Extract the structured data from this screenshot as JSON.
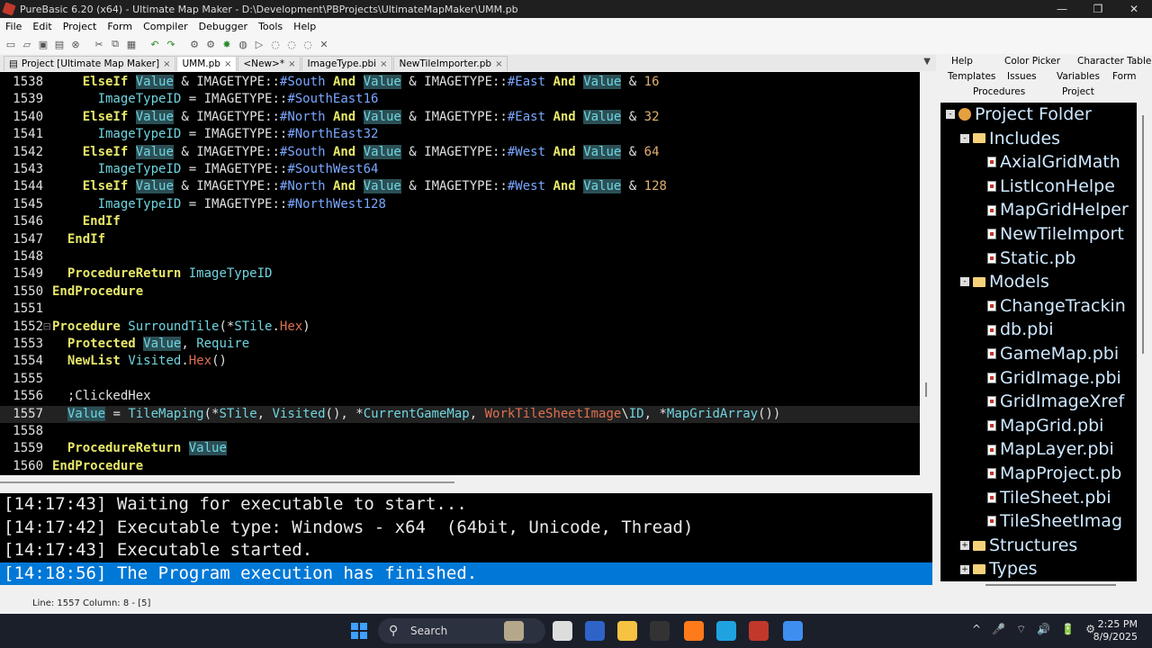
{
  "window": {
    "title": "PureBasic 6.20 (x64) - Ultimate Map Maker - D:\\Development\\PBProjects\\UltimateMapMaker\\UMM.pb",
    "minimize": "—",
    "restore": "❐",
    "close": "✕"
  },
  "menu": [
    "File",
    "Edit",
    "Project",
    "Form",
    "Compiler",
    "Debugger",
    "Tools",
    "Help"
  ],
  "file_tabs": [
    {
      "label": "Project [Ultimate Map Maker]",
      "active": false
    },
    {
      "label": "UMM.pb",
      "active": true
    },
    {
      "label": "<New>*",
      "active": false
    },
    {
      "label": "ImageType.pbi",
      "active": false
    },
    {
      "label": "NewTileImporter.pb",
      "active": false
    }
  ],
  "tab_close": "×",
  "tab_menu": "▼",
  "right_tabs": {
    "help": "Help",
    "color_picker": "Color Picker",
    "character_table": "Character Table",
    "templates": "Templates",
    "issues": "Issues",
    "variables": "Variables",
    "form": "Form",
    "procedures": "Procedures",
    "project": "Project"
  },
  "code_lines": [
    {
      "n": "1538",
      "text": "    ElseIf Value & IMAGETYPE::#South And Value & IMAGETYPE::#East And Value & 16"
    },
    {
      "n": "1539",
      "text": "      ImageTypeID = IMAGETYPE::#SouthEast16"
    },
    {
      "n": "1540",
      "text": "    ElseIf Value & IMAGETYPE::#North And Value & IMAGETYPE::#East And Value & 32"
    },
    {
      "n": "1541",
      "text": "      ImageTypeID = IMAGETYPE::#NorthEast32"
    },
    {
      "n": "1542",
      "text": "    ElseIf Value & IMAGETYPE::#South And Value & IMAGETYPE::#West And Value & 64"
    },
    {
      "n": "1543",
      "text": "      ImageTypeID = IMAGETYPE::#SouthWest64"
    },
    {
      "n": "1544",
      "text": "    ElseIf Value & IMAGETYPE::#North And Value & IMAGETYPE::#West And Value & 128"
    },
    {
      "n": "1545",
      "text": "      ImageTypeID = IMAGETYPE::#NorthWest128"
    },
    {
      "n": "1546",
      "text": "    EndIf"
    },
    {
      "n": "1547",
      "text": "  EndIf"
    },
    {
      "n": "1548",
      "text": ""
    },
    {
      "n": "1549",
      "text": "  ProcedureReturn ImageTypeID"
    },
    {
      "n": "1550",
      "text": "EndProcedure"
    },
    {
      "n": "1551",
      "text": ""
    },
    {
      "n": "1552",
      "text": "Procedure SurroundTile(*STile.Hex)"
    },
    {
      "n": "1553",
      "text": "  Protected Value, Require"
    },
    {
      "n": "1554",
      "text": "  NewList Visited.Hex()"
    },
    {
      "n": "1555",
      "text": ""
    },
    {
      "n": "1556",
      "text": "  ;ClickedHex"
    },
    {
      "n": "1557",
      "text": "  Value = TileMaping(*STile, Visited(), *CurrentGameMap, WorkTileSheetImage\\ID, *MapGridArray())"
    },
    {
      "n": "1558",
      "text": ""
    },
    {
      "n": "1559",
      "text": "  ProcedureReturn Value"
    },
    {
      "n": "1560",
      "text": "EndProcedure"
    }
  ],
  "current_line_index": 19,
  "log": [
    {
      "text": "[14:17:43] Waiting for executable to start...",
      "selected": false
    },
    {
      "text": "[14:17:42] Executable type: Windows - x64  (64bit, Unicode, Thread)",
      "selected": false
    },
    {
      "text": "[14:17:43] Executable started.",
      "selected": false
    },
    {
      "text": "[14:18:56] The Program execution has finished.",
      "selected": true
    }
  ],
  "status": "Line: 1557  Column: 8 - [5]",
  "tree": [
    {
      "depth": 0,
      "kind": "root",
      "label": "Project Folder",
      "toggle": "-"
    },
    {
      "depth": 1,
      "kind": "folder",
      "label": "Includes",
      "toggle": "-"
    },
    {
      "depth": 2,
      "kind": "file",
      "label": "AxialGridMath"
    },
    {
      "depth": 2,
      "kind": "file",
      "label": "ListIconHelpe"
    },
    {
      "depth": 2,
      "kind": "file",
      "label": "MapGridHelper"
    },
    {
      "depth": 2,
      "kind": "file",
      "label": "NewTileImport"
    },
    {
      "depth": 2,
      "kind": "file",
      "label": "Static.pb"
    },
    {
      "depth": 1,
      "kind": "folder",
      "label": "Models",
      "toggle": "-"
    },
    {
      "depth": 2,
      "kind": "file",
      "label": "ChangeTrackin"
    },
    {
      "depth": 2,
      "kind": "file",
      "label": "db.pbi"
    },
    {
      "depth": 2,
      "kind": "file",
      "label": "GameMap.pbi"
    },
    {
      "depth": 2,
      "kind": "file",
      "label": "GridImage.pbi"
    },
    {
      "depth": 2,
      "kind": "file",
      "label": "GridImageXref"
    },
    {
      "depth": 2,
      "kind": "file",
      "label": "MapGrid.pbi"
    },
    {
      "depth": 2,
      "kind": "file",
      "label": "MapLayer.pbi"
    },
    {
      "depth": 2,
      "kind": "file",
      "label": "MapProject.pb"
    },
    {
      "depth": 2,
      "kind": "file",
      "label": "TileSheet.pbi"
    },
    {
      "depth": 2,
      "kind": "file",
      "label": "TileSheetImag"
    },
    {
      "depth": 1,
      "kind": "folder",
      "label": "Structures",
      "toggle": "+"
    },
    {
      "depth": 1,
      "kind": "folder",
      "label": "Types",
      "toggle": "+"
    }
  ],
  "taskbar": {
    "search": "Search",
    "search_icon": "⚲",
    "time": "2:25 PM",
    "date": "8/9/2025",
    "tray_icons": [
      "^",
      "🎤",
      "⌔",
      "🔊",
      "🔋",
      "⚙"
    ],
    "apps": [
      {
        "name": "widgets",
        "color": "#b5a88a"
      },
      {
        "name": "task-view",
        "color": "#dddddd"
      },
      {
        "name": "app-blue",
        "color": "#2e64c8"
      },
      {
        "name": "file-explorer",
        "color": "#f5c242"
      },
      {
        "name": "amazon",
        "color": "#333333"
      },
      {
        "name": "firefox",
        "color": "#ff7a1a"
      },
      {
        "name": "edge",
        "color": "#1fa3e0"
      },
      {
        "name": "purebasic",
        "color": "#c0392b"
      },
      {
        "name": "visual-studio",
        "color": "#3e8ef0"
      }
    ]
  },
  "colors": {
    "editor_bg": "#000000",
    "keyword": "#e8e86a",
    "variable": "#6fd5e0",
    "constant": "#7aa7ff",
    "number": "#e0b070",
    "log_selection": "#0078d7"
  }
}
